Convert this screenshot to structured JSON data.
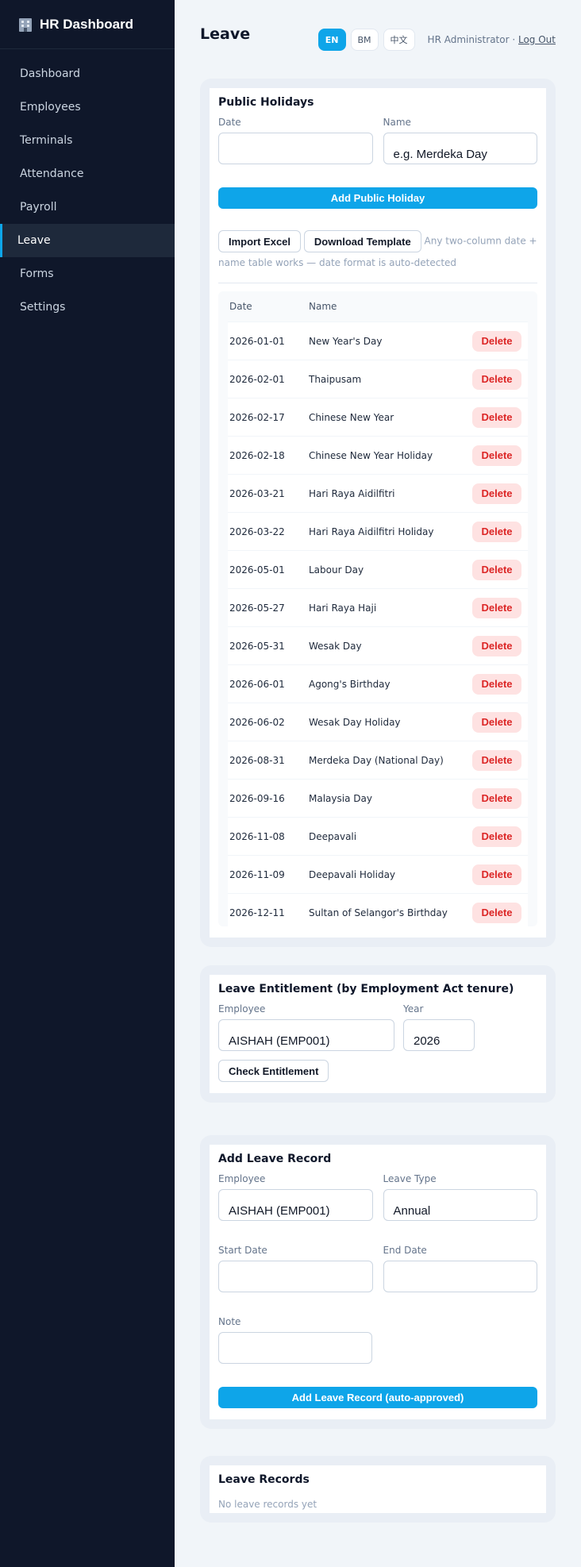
{
  "sidebar": {
    "brand": "HR Dashboard",
    "items": [
      {
        "label": "Dashboard"
      },
      {
        "label": "Employees"
      },
      {
        "label": "Terminals"
      },
      {
        "label": "Attendance"
      },
      {
        "label": "Payroll"
      },
      {
        "label": "Leave",
        "active": true
      },
      {
        "label": "Forms"
      },
      {
        "label": "Settings"
      }
    ]
  },
  "header": {
    "title": "Leave",
    "languages": [
      "EN",
      "BM",
      "中文"
    ],
    "active_language": "EN",
    "user": "HR Administrator ·",
    "logout": "Log Out"
  },
  "public_holidays": {
    "title": "Public Holidays",
    "date_label": "Date",
    "date_value": "",
    "name_label": "Name",
    "name_placeholder": "e.g. Merdeka Day",
    "add_button": "Add Public Holiday",
    "import_button": "Import Excel",
    "template_button": "Download Template",
    "import_hint": "Any two-column date + name table works — date format is auto-detected",
    "columns": [
      "Date",
      "Name"
    ],
    "delete_label": "Delete",
    "rows": [
      {
        "date": "2026-01-01",
        "name": "New Year's Day"
      },
      {
        "date": "2026-02-01",
        "name": "Thaipusam"
      },
      {
        "date": "2026-02-17",
        "name": "Chinese New Year"
      },
      {
        "date": "2026-02-18",
        "name": "Chinese New Year Holiday"
      },
      {
        "date": "2026-03-21",
        "name": "Hari Raya Aidilfitri"
      },
      {
        "date": "2026-03-22",
        "name": "Hari Raya Aidilfitri Holiday"
      },
      {
        "date": "2026-05-01",
        "name": "Labour Day"
      },
      {
        "date": "2026-05-27",
        "name": "Hari Raya Haji"
      },
      {
        "date": "2026-05-31",
        "name": "Wesak Day"
      },
      {
        "date": "2026-06-01",
        "name": "Agong's Birthday"
      },
      {
        "date": "2026-06-02",
        "name": "Wesak Day Holiday"
      },
      {
        "date": "2026-08-31",
        "name": "Merdeka Day (National Day)"
      },
      {
        "date": "2026-09-16",
        "name": "Malaysia Day"
      },
      {
        "date": "2026-11-08",
        "name": "Deepavali"
      },
      {
        "date": "2026-11-09",
        "name": "Deepavali Holiday"
      },
      {
        "date": "2026-12-11",
        "name": "Sultan of Selangor's Birthday"
      }
    ]
  },
  "entitlement": {
    "title": "Leave Entitlement (by Employment Act tenure)",
    "employee_label": "Employee",
    "employee_value": "AISHAH (EMP001)",
    "year_label": "Year",
    "year_value": "2026",
    "check_button": "Check Entitlement"
  },
  "add_leave": {
    "title": "Add Leave Record",
    "employee_label": "Employee",
    "employee_value": "AISHAH (EMP001)",
    "type_label": "Leave Type",
    "type_value": "Annual",
    "start_label": "Start Date",
    "start_value": "",
    "end_label": "End Date",
    "end_value": "",
    "note_label": "Note",
    "note_value": "",
    "submit_button": "Add Leave Record (auto-approved)"
  },
  "leave_records": {
    "title": "Leave Records",
    "empty": "No leave records yet"
  },
  "colors": {
    "accent": "#0ea5e9",
    "sidebar_bg": "#0f172a",
    "danger": "#dc2626",
    "danger_bg": "#fee2e2"
  }
}
